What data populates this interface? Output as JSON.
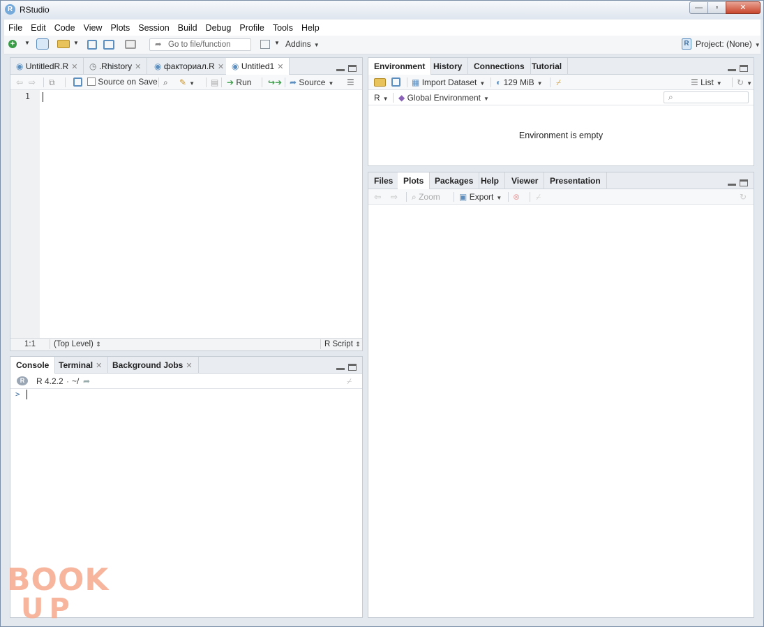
{
  "window": {
    "title": "RStudio",
    "logo": "R",
    "min": "—",
    "max": "▫",
    "close": "✕"
  },
  "menu": [
    "File",
    "Edit",
    "Code",
    "View",
    "Plots",
    "Session",
    "Build",
    "Debug",
    "Profile",
    "Tools",
    "Help"
  ],
  "toolbar": {
    "goto_placeholder": "Go to file/function",
    "addins_label": "Addins",
    "project_label": "Project: (None)"
  },
  "editor": {
    "tabs": [
      {
        "label": "UntitledR.R",
        "icon": "r-file-icon"
      },
      {
        "label": ".Rhistory",
        "icon": "history-file-icon"
      },
      {
        "label": "факториал.R",
        "icon": "r-file-icon"
      },
      {
        "label": "Untitled1",
        "icon": "r-file-icon"
      }
    ],
    "active_tab": 3,
    "source_on_save_label": "Source on Save",
    "run_label": "Run",
    "source_label": "Source",
    "line_numbers": [
      "1"
    ],
    "status": {
      "position": "1:1",
      "scope": "(Top Level)",
      "filetype": "R Script"
    }
  },
  "console": {
    "tabs": [
      {
        "label": "Console"
      },
      {
        "label": "Terminal"
      },
      {
        "label": "Background Jobs"
      }
    ],
    "version": "R 4.2.2",
    "wd": "~/",
    "prompt": ">"
  },
  "environment": {
    "tabs": [
      "Environment",
      "History",
      "Connections",
      "Tutorial"
    ],
    "import_label": "Import Dataset",
    "memory_label": "129 MiB",
    "list_label": "List",
    "lang_label": "R",
    "env_label": "Global Environment",
    "empty_message": "Environment is empty"
  },
  "files": {
    "tabs": [
      "Files",
      "Plots",
      "Packages",
      "Help",
      "Viewer",
      "Presentation"
    ],
    "zoom_label": "Zoom",
    "export_label": "Export"
  },
  "watermark": {
    "top": "BOOK",
    "bottom": "UP"
  },
  "colors": {
    "accent_blue": "#75aadb",
    "watermark": "#f6a98e",
    "run_green": "#3a9b47"
  }
}
